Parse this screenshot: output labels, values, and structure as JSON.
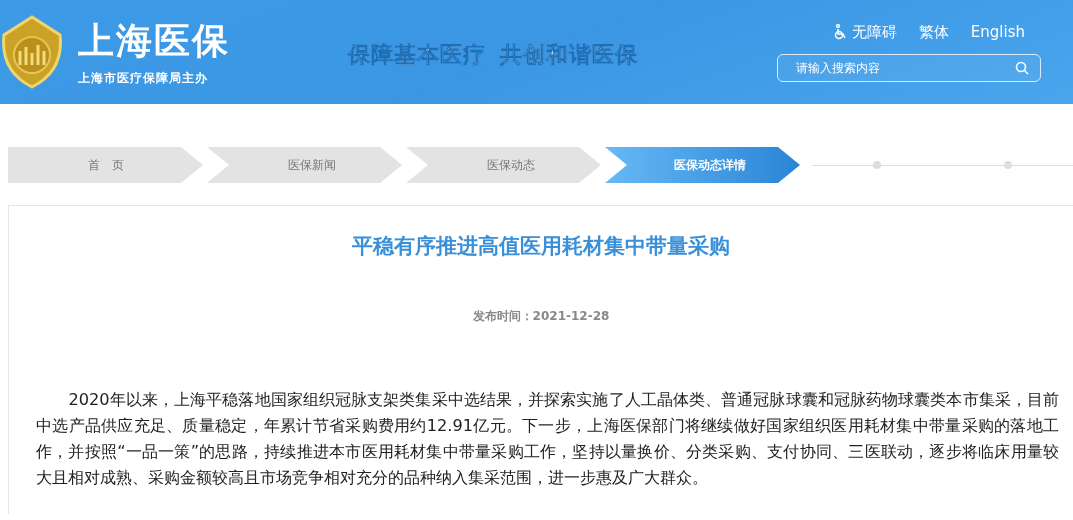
{
  "header": {
    "logo_title": "上海医保",
    "logo_subtitle": "上海市医疗保障局主办",
    "slogan": [
      "保障基本医疗",
      "共创和谐医保"
    ],
    "links": [
      {
        "kind": "accessibility",
        "label": "无障碍"
      },
      {
        "kind": "plain",
        "label": "繁体"
      },
      {
        "kind": "plain",
        "label": "English"
      }
    ],
    "search": {
      "placeholder": "请输入搜索内容"
    }
  },
  "breadcrumb": [
    {
      "label": "首　页",
      "selected": false
    },
    {
      "label": "医保新闻",
      "selected": false
    },
    {
      "label": "医保动态",
      "selected": false
    },
    {
      "label": "医保动态详情",
      "selected": true
    }
  ],
  "article": {
    "title": "平稳有序推进高值医用耗材集中带量采购",
    "date_label": "发布时间：",
    "date": "2021-12-28",
    "body": "2020年以来，上海平稳落地国家组织冠脉支架类集采中选结果，并探索实施了人工晶体类、普通冠脉球囊和冠脉药物球囊类本市集采，目前中选产品供应充足、质量稳定，年累计节省采购费用约12.91亿元。下一步，上海医保部门将继续做好国家组织医用耗材集中带量采购的落地工作，并按照“一品一策”的思路，持续推进本市医用耗材集中带量采购工作，坚持以量换价、分类采购、支付协同、三医联动，逐步将临床用量较大且相对成熟、采购金额较高且市场竞争相对充分的品种纳入集采范围，进一步惠及广大群众。"
  }
}
